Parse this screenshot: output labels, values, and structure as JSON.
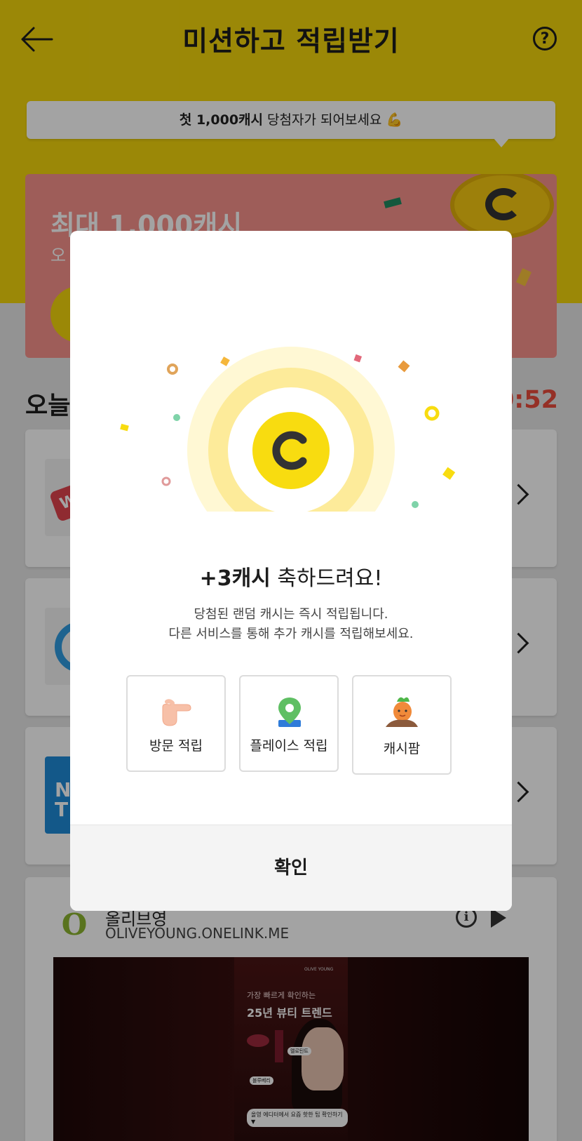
{
  "header": {
    "title": "미션하고 적립받기",
    "help_icon_glyph": "?"
  },
  "tooltip": {
    "bold_text": "첫 1,000캐시",
    "text": " 당첨자가 되어보세요 💪"
  },
  "banner": {
    "title": "최대 1,000캐시",
    "subtitle": "오"
  },
  "today": {
    "label": "오늘",
    "timer": "0:52"
  },
  "cards": [
    {
      "logo_text": "W",
      "logo_color": "#e0444d"
    },
    {
      "logo_text": "C",
      "logo_color": "#2f9be0"
    },
    {
      "logo_text": "N",
      "logo_color": "#1f8ad6"
    }
  ],
  "ad": {
    "brand_name": "올리브영",
    "logo_letter": "O",
    "url": "OLIVEYOUNG.ONELINK.ME",
    "info_glyph": "i",
    "poster_brand": "OLIVE YOUNG",
    "poster_small": "가장 빠르게 확인하는",
    "poster_title": "25년 뷰티 트렌드",
    "poster_tag1": "멜로틴트",
    "poster_tag2": "블루베리",
    "poster_cta": "올영 에디터에서 요즘 핫한 팁 확인하기 ▼"
  },
  "modal": {
    "coin_letter": "C",
    "title_bold": "+3캐시",
    "title_rest": " 축하드려요!",
    "desc_line1": "당첨된 랜덤 캐시는 즉시 적립됩니다.",
    "desc_line2": "다른 서비스를 통해 추가 캐시를 적립해보세요.",
    "options": [
      {
        "label": "방문 적립",
        "icon": "pointing-hand-icon"
      },
      {
        "label": "플레이스 적립",
        "icon": "map-pin-icon"
      },
      {
        "label": "캐시팜",
        "icon": "carrot-character-icon"
      }
    ],
    "confirm_label": "확인"
  },
  "colors": {
    "brand_yellow": "#f3d50c",
    "coin_yellow": "#f8dc10",
    "banner_red": "#f7928c",
    "timer_red": "#e94b3c"
  }
}
